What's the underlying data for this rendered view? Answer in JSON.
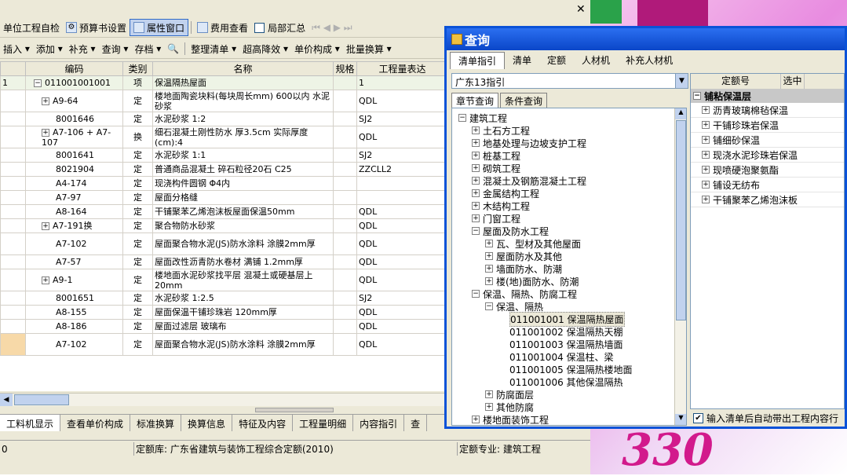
{
  "toolbar1": {
    "items": [
      "单位工程自检",
      "预算书设置",
      "属性窗口",
      "费用查看",
      "局部汇总"
    ]
  },
  "toolbar2": {
    "items": [
      "插入",
      "添加",
      "补充",
      "查询",
      "存档",
      "整理清单",
      "超高降效",
      "单价构成",
      "批量换算"
    ]
  },
  "grid": {
    "headers": [
      "编码",
      "类别",
      "名称",
      "规格",
      "工程量表达"
    ],
    "rows": [
      {
        "num": "1",
        "code": "011001001001",
        "type": "项",
        "name": "保温隔热屋面",
        "spec": "",
        "expr": "1",
        "exp": "−"
      },
      {
        "num": "",
        "code": "A9-64",
        "type": "定",
        "name": "楼地面陶瓷块料(每块周长mm) 600以内 水泥砂浆",
        "spec": "",
        "expr": "QDL",
        "exp": "+"
      },
      {
        "num": "",
        "code": "8001646",
        "type": "定",
        "name": "水泥砂浆 1:2",
        "spec": "",
        "expr": "SJ2",
        "exp": ""
      },
      {
        "num": "",
        "code": "A7-106 + A7-107",
        "type": "换",
        "name": "细石混凝土刚性防水 厚3.5cm 实际厚度(cm):4",
        "spec": "",
        "expr": "QDL",
        "exp": "+"
      },
      {
        "num": "",
        "code": "8001641",
        "type": "定",
        "name": "水泥砂浆 1:1",
        "spec": "",
        "expr": "SJ2",
        "exp": ""
      },
      {
        "num": "",
        "code": "8021904",
        "type": "定",
        "name": "普通商品混凝土 碎石粒径20石 C25",
        "spec": "",
        "expr": "ZZCLL2",
        "exp": ""
      },
      {
        "num": "",
        "code": "A4-174",
        "type": "定",
        "name": "现浇构件圆钢 Φ4内",
        "spec": "",
        "expr": "",
        "exp": ""
      },
      {
        "num": "",
        "code": "A7-97",
        "type": "定",
        "name": "屋面分格缝",
        "spec": "",
        "expr": "",
        "exp": ""
      },
      {
        "num": "",
        "code": "A8-164",
        "type": "定",
        "name": "干铺聚苯乙烯泡沫板屋面保温50mm",
        "spec": "",
        "expr": "QDL",
        "exp": ""
      },
      {
        "num": "",
        "code": "A7-191换",
        "type": "定",
        "name": "聚合物防水砂浆",
        "spec": "",
        "expr": "QDL",
        "exp": "+"
      },
      {
        "num": "",
        "code": "A7-102",
        "type": "定",
        "name": "屋面聚合物水泥(JS)防水涂料 涂膜2mm厚",
        "spec": "",
        "expr": "QDL",
        "exp": ""
      },
      {
        "num": "",
        "code": "A7-57",
        "type": "定",
        "name": "屋面改性沥青防水卷材 满铺 1.2mm厚",
        "spec": "",
        "expr": "QDL",
        "exp": ""
      },
      {
        "num": "",
        "code": "A9-1",
        "type": "定",
        "name": "楼地面水泥砂浆找平层 混凝土或硬基层上 20mm",
        "spec": "",
        "expr": "QDL",
        "exp": "+"
      },
      {
        "num": "",
        "code": "8001651",
        "type": "定",
        "name": "水泥砂浆 1:2.5",
        "spec": "",
        "expr": "SJ2",
        "exp": ""
      },
      {
        "num": "",
        "code": "A8-155",
        "type": "定",
        "name": "屋面保温干铺珍珠岩 120mm厚",
        "spec": "",
        "expr": "QDL",
        "exp": ""
      },
      {
        "num": "",
        "code": "A8-186",
        "type": "定",
        "name": "屋面过滤层 玻璃布",
        "spec": "",
        "expr": "QDL",
        "exp": ""
      },
      {
        "num": "",
        "code": "A7-102",
        "type": "定",
        "name": "屋面聚合物水泥(JS)防水涂料 涂膜2mm厚",
        "spec": "",
        "expr": "QDL",
        "exp": ""
      }
    ]
  },
  "bottom_tabs": [
    "工料机显示",
    "查看单价构成",
    "标准换算",
    "换算信息",
    "特征及内容",
    "工程量明细",
    "内容指引",
    "查"
  ],
  "status": {
    "left": "0",
    "quota_lib": "定额库: 广东省建筑与装饰工程综合定额(2010)",
    "quota_major": "定额专业: 建筑工程"
  },
  "dialog": {
    "title": "查询",
    "tabs": [
      "清单指引",
      "清单",
      "定额",
      "人材机",
      "补充人材机"
    ],
    "combo": "广东13指引",
    "subtabs": [
      "章节查询",
      "条件查询"
    ],
    "tree": [
      {
        "lvl": 0,
        "exp": "−",
        "text": "建筑工程"
      },
      {
        "lvl": 1,
        "exp": "+",
        "text": "土石方工程"
      },
      {
        "lvl": 1,
        "exp": "+",
        "text": "地基处理与边坡支护工程"
      },
      {
        "lvl": 1,
        "exp": "+",
        "text": "桩基工程"
      },
      {
        "lvl": 1,
        "exp": "+",
        "text": "砌筑工程"
      },
      {
        "lvl": 1,
        "exp": "+",
        "text": "混凝土及钢筋混凝土工程"
      },
      {
        "lvl": 1,
        "exp": "+",
        "text": "金属结构工程"
      },
      {
        "lvl": 1,
        "exp": "+",
        "text": "木结构工程"
      },
      {
        "lvl": 1,
        "exp": "+",
        "text": "门窗工程"
      },
      {
        "lvl": 1,
        "exp": "−",
        "text": "屋面及防水工程"
      },
      {
        "lvl": 2,
        "exp": "+",
        "text": "瓦、型材及其他屋面"
      },
      {
        "lvl": 2,
        "exp": "+",
        "text": "屋面防水及其他"
      },
      {
        "lvl": 2,
        "exp": "+",
        "text": "墙面防水、防潮"
      },
      {
        "lvl": 2,
        "exp": "+",
        "text": "楼(地)面防水、防潮"
      },
      {
        "lvl": 1,
        "exp": "−",
        "text": "保温、隔热、防腐工程"
      },
      {
        "lvl": 2,
        "exp": "−",
        "text": "保温、隔热"
      },
      {
        "lvl": 3,
        "exp": "",
        "text": "011001001  保温隔热屋面",
        "sel": true
      },
      {
        "lvl": 3,
        "exp": "",
        "text": "011001002  保温隔热天棚"
      },
      {
        "lvl": 3,
        "exp": "",
        "text": "011001003  保温隔热墙面"
      },
      {
        "lvl": 3,
        "exp": "",
        "text": "011001004  保温柱、梁"
      },
      {
        "lvl": 3,
        "exp": "",
        "text": "011001005  保温隔热楼地面"
      },
      {
        "lvl": 3,
        "exp": "",
        "text": "011001006  其他保温隔热"
      },
      {
        "lvl": 2,
        "exp": "+",
        "text": "防腐面层"
      },
      {
        "lvl": 2,
        "exp": "+",
        "text": "其他防腐"
      },
      {
        "lvl": 1,
        "exp": "+",
        "text": "楼地面装饰工程"
      }
    ],
    "right_headers": [
      "定额号",
      "选中"
    ],
    "right_group": "铺粘保温层",
    "right_items": [
      "沥青玻璃棉毡保温",
      "干铺珍珠岩保温",
      "铺细砂保温",
      "现浇水泥珍珠岩保温",
      "现喷硬泡聚氨酯",
      "铺设无纺布",
      "干铺聚苯乙烯泡沫板"
    ],
    "checkbox": "输入清单后自动带出工程内容行"
  },
  "desktop": {
    "big_text": "330"
  }
}
